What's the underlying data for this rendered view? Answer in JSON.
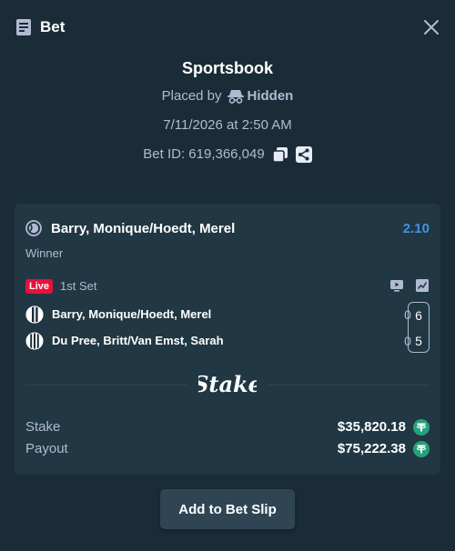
{
  "header": {
    "title": "Bet",
    "icon": "bet-slip-icon",
    "close_icon": "close-icon"
  },
  "info": {
    "book": "Sportsbook",
    "placed_by_label": "Placed by",
    "placed_by_user": "Hidden",
    "date": "7/11/2026 at 2:50 AM",
    "bet_id": "Bet ID: 619,366,049",
    "copy_icon": "copy-icon",
    "share_icon": "share-icon"
  },
  "bet": {
    "match": "Barry, Monique/Hoedt, Merel",
    "odds": "2.10",
    "market": "Winner",
    "live_label": "Live",
    "period": "1st Set",
    "teams": [
      {
        "name": "Barry, Monique/Hoedt, Merel",
        "games": "0",
        "set": "6"
      },
      {
        "name": "Du Pree, Britt/Van Emst, Sarah",
        "games": "0",
        "set": "5"
      }
    ],
    "logo_text": "Stake",
    "stake_label": "Stake",
    "stake_amount": "$35,820.18",
    "payout_label": "Payout",
    "payout_amount": "$75,222.38",
    "currency_icon": "tether-icon"
  },
  "actions": {
    "add_to_slip": "Add to Bet Slip"
  },
  "colors": {
    "background": "#1a2c38",
    "card": "#213743",
    "odds": "#4391e7",
    "live": "#e9113c",
    "button": "#2f4553",
    "tether": "#26a17b"
  }
}
